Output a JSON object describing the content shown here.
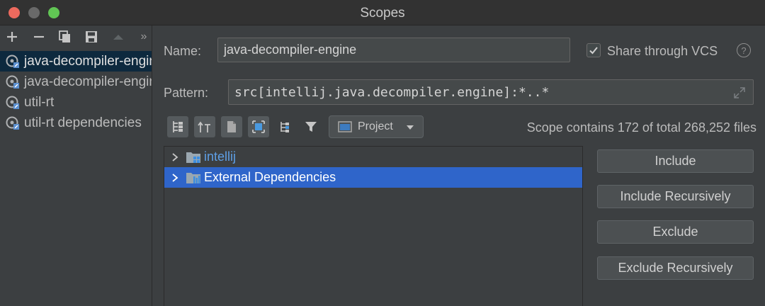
{
  "window": {
    "title": "Scopes"
  },
  "sidebar": {
    "toolbar": [
      "add-icon",
      "remove-icon",
      "copy-icon",
      "save-icon",
      "move-up-icon",
      "more-icon"
    ],
    "items": [
      {
        "label": "java-decompiler-engine",
        "selected": true
      },
      {
        "label": "java-decompiler-engine",
        "selected": false
      },
      {
        "label": "util-rt",
        "selected": false
      },
      {
        "label": "util-rt dependencies",
        "selected": false
      }
    ]
  },
  "form": {
    "name_label": "Name:",
    "name_value": "java-decompiler-engine",
    "share_label": "Share through VCS",
    "share_checked": true,
    "pattern_label": "Pattern:",
    "pattern_value": "src[intellij.java.decompiler.engine]:*..*"
  },
  "tree_toolbar": {
    "view_select": "Project",
    "scope_info": "Scope contains 172 of total 268,252 files"
  },
  "tree": {
    "rows": [
      {
        "label": "intellij",
        "selected": false
      },
      {
        "label": "External Dependencies",
        "selected": true
      }
    ]
  },
  "actions": {
    "include": "Include",
    "include_recursively": "Include Recursively",
    "exclude": "Exclude",
    "exclude_recursively": "Exclude Recursively"
  },
  "colors": {
    "background": "#3c3f41",
    "selection": "#2f65ca",
    "sidebar_selection": "#0d293e",
    "link_blue": "#5e9fe6"
  }
}
